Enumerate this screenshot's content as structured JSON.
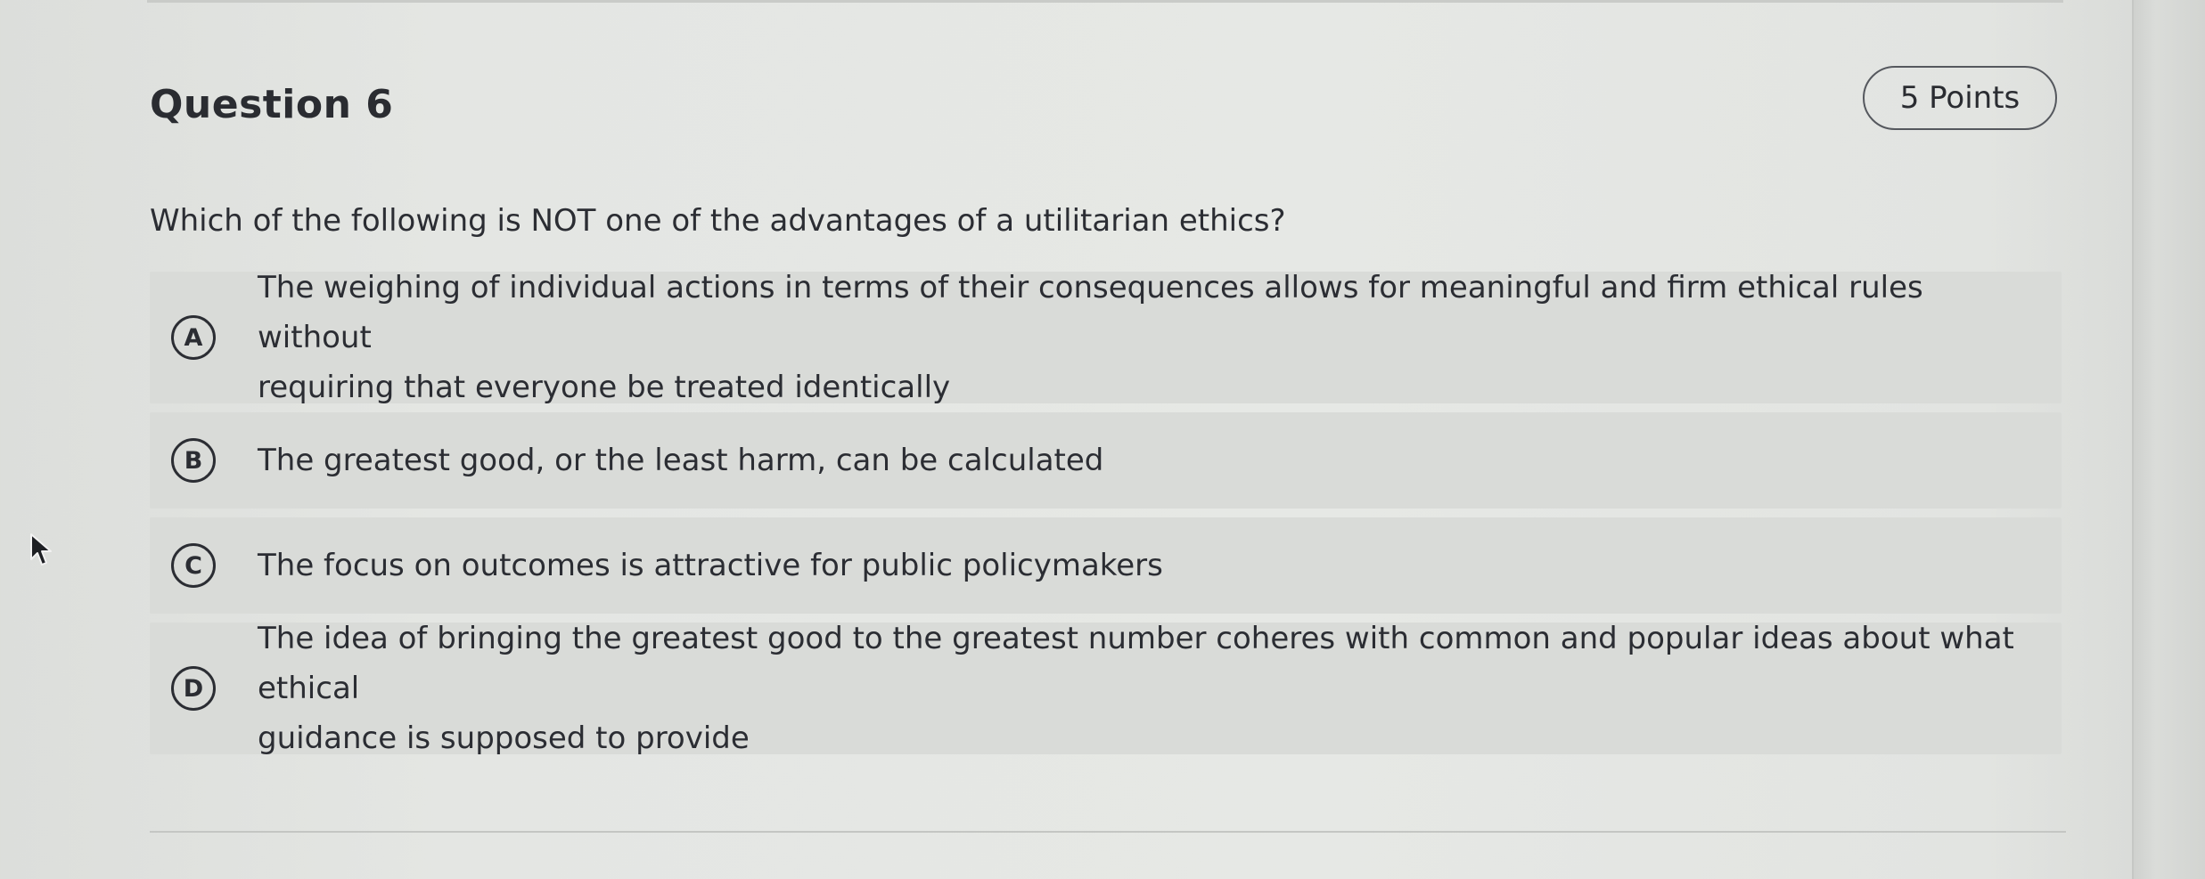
{
  "question": {
    "title": "Question 6",
    "points": "5 Points",
    "prompt": "Which of the following is NOT one of the advantages of a utilitarian ethics?"
  },
  "options": [
    {
      "letter": "A",
      "line1": "The weighing of individual actions in terms of their consequences allows for meaningful and firm ethical rules without",
      "line2": "requiring that everyone be treated identically"
    },
    {
      "letter": "B",
      "line1": "The greatest good, or the least harm, can be calculated"
    },
    {
      "letter": "C",
      "line1": "The focus on outcomes is attractive for public policymakers"
    },
    {
      "letter": "D",
      "line1": "The idea of bringing the greatest good to the greatest number coheres with common and popular ideas about what ethical",
      "line2": "guidance is supposed to provide"
    }
  ],
  "icons": {
    "cursor": "mouse-pointer-icon"
  },
  "colors": {
    "background": "#e4e6e3",
    "option_background": "#d9dbd8",
    "text": "#2b2d33"
  }
}
